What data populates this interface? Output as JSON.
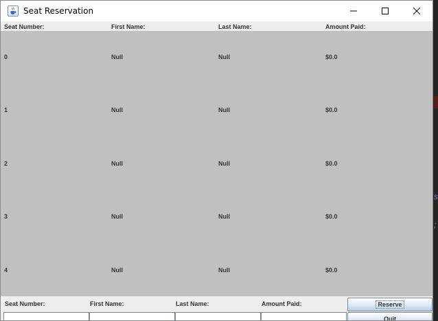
{
  "window": {
    "title": "Seat Reservation"
  },
  "table": {
    "headers": [
      "Seat Number:",
      "First Name:",
      "Last Name:",
      "Amount Paid:"
    ],
    "rows": [
      [
        "0",
        "Null",
        "Null",
        "$0.0"
      ],
      [
        "1",
        "Null",
        "Null",
        "$0.0"
      ],
      [
        "2",
        "Null",
        "Null",
        "$0.0"
      ],
      [
        "3",
        "Null",
        "Null",
        "$0.0"
      ],
      [
        "4",
        "Null",
        "Null",
        "$0.0"
      ]
    ]
  },
  "form": {
    "labels": [
      "Seat Number:",
      "First Name:",
      "Last Name:",
      "Amount Paid:"
    ],
    "values": [
      "",
      "",
      "",
      ""
    ],
    "reserve_label": "Reserve",
    "quit_label": "Quit"
  },
  "icons": {
    "app": "java-cup-icon",
    "minimize": "minimize-icon",
    "maximize": "maximize-icon",
    "close": "close-icon"
  },
  "colors": {
    "rows_background": "#c0c0c0",
    "button_gradient_top": "#ffffff",
    "button_gradient_bottom": "#b8cfe5"
  }
}
